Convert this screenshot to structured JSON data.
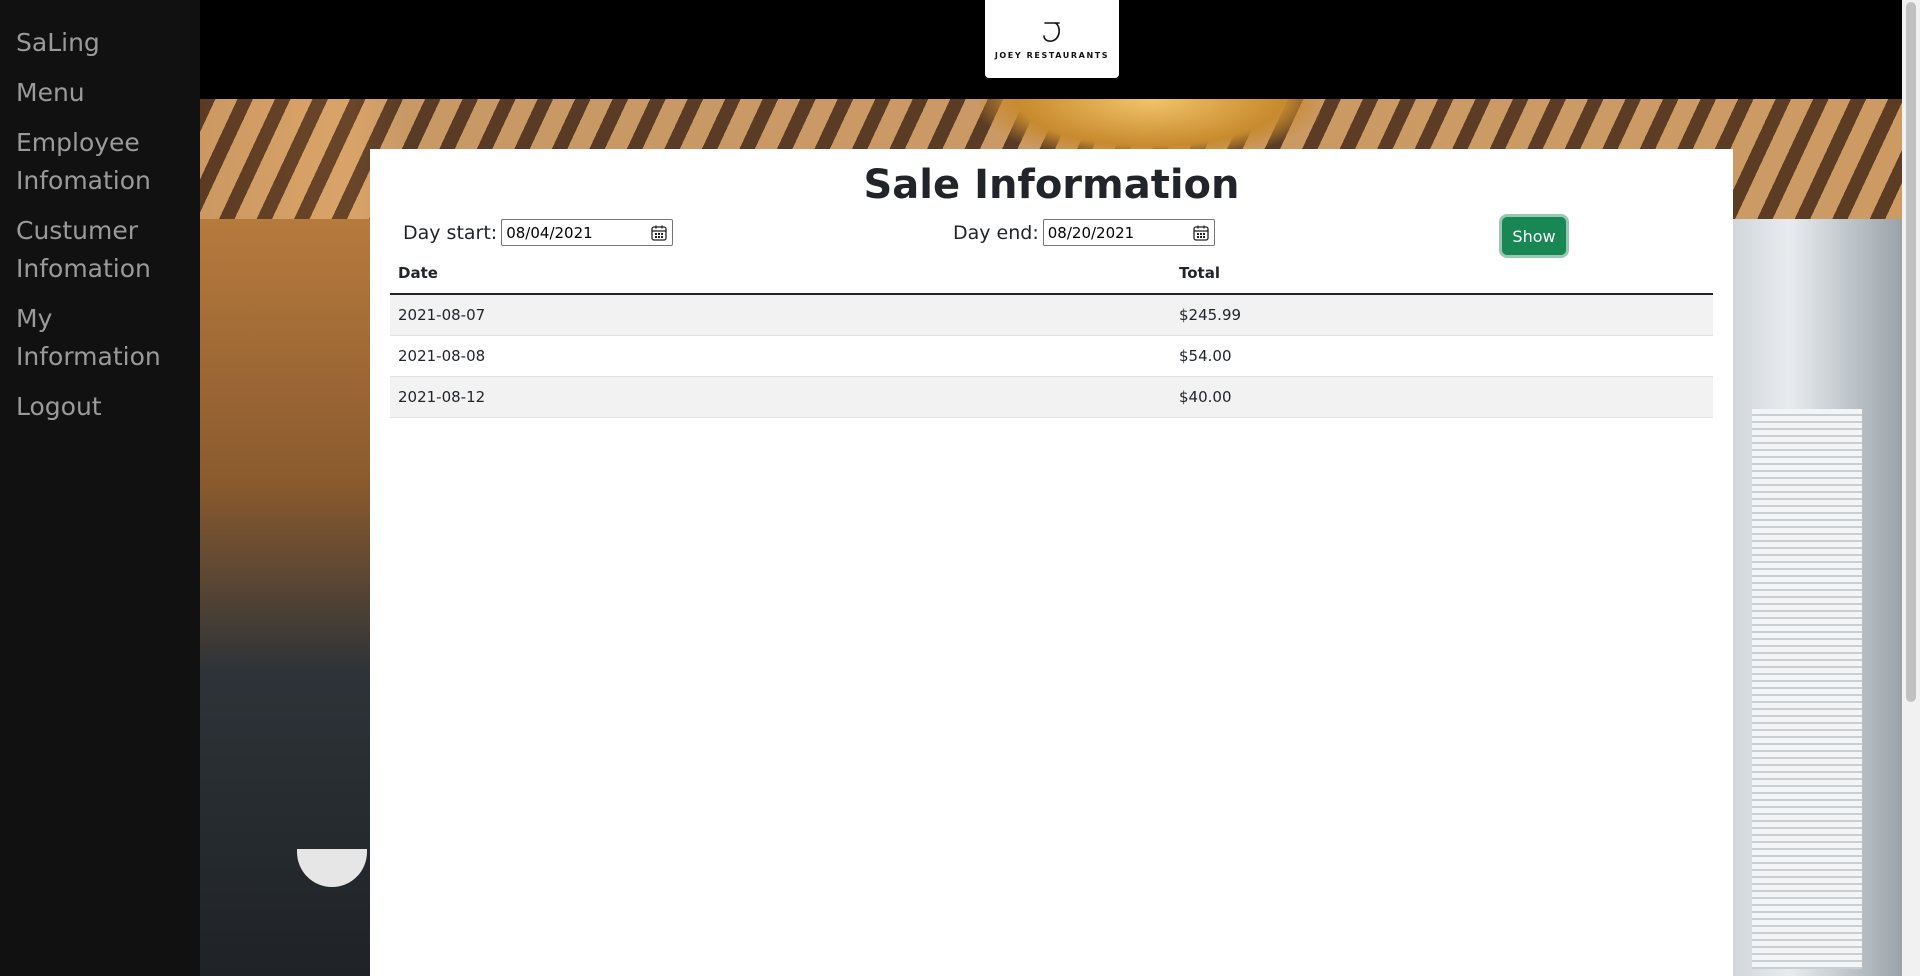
{
  "sidebar": {
    "items": [
      {
        "label": "SaLing"
      },
      {
        "label": "Menu"
      },
      {
        "label": "Employee Infomation"
      },
      {
        "label": "Custumer Infomation"
      },
      {
        "label": "My Information"
      },
      {
        "label": "Logout"
      }
    ]
  },
  "header": {
    "logo_text": "JOEY RESTAURANTS"
  },
  "main": {
    "title": "Sale Information",
    "filters": {
      "start_label": "Day start:",
      "start_value": "08/04/2021",
      "end_label": "Day end:",
      "end_value": "08/20/2021",
      "show_label": "Show"
    },
    "table": {
      "columns": [
        "Date",
        "Total"
      ],
      "rows": [
        {
          "date": "2021-08-07",
          "total": "$245.99"
        },
        {
          "date": "2021-08-08",
          "total": "$54.00"
        },
        {
          "date": "2021-08-12",
          "total": "$40.00"
        }
      ]
    }
  },
  "colors": {
    "sidebar_bg": "#111111",
    "header_bg": "#000000",
    "show_button": "#198754"
  }
}
